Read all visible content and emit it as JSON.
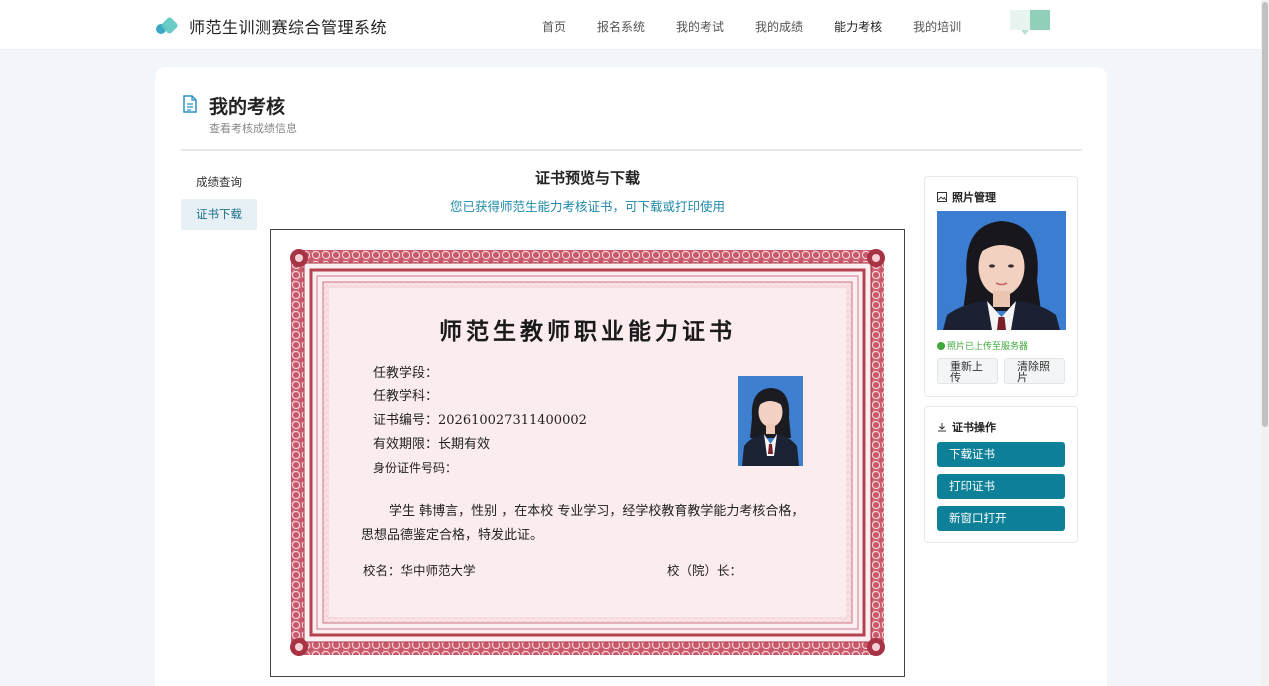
{
  "header": {
    "app_title": "师范生训测赛综合管理系统",
    "nav": [
      {
        "label": "首页"
      },
      {
        "label": "报名系统"
      },
      {
        "label": "我的考试"
      },
      {
        "label": "我的成绩"
      },
      {
        "label": "能力考核"
      },
      {
        "label": "我的培训"
      }
    ],
    "active_nav": "能力考核"
  },
  "page": {
    "title": "我的考核",
    "subtitle": "查看考核成绩信息"
  },
  "side_menu": {
    "items": [
      {
        "label": "成绩查询"
      },
      {
        "label": "证书下载"
      }
    ],
    "active": "证书下载"
  },
  "certificate_section": {
    "title": "证书预览与下载",
    "subtitle": "您已获得师范生能力考核证书，可下载或打印使用"
  },
  "certificate": {
    "title": "师范生教师职业能力证书",
    "field_stage": "任教学段：",
    "field_subject": "任教学科：",
    "field_number": "证书编号：202610027311400002",
    "field_validity": "有效期限：长期有效",
    "field_id": "身份证件号码：",
    "body": "学生 韩博言，性别 ，在本校 专业学习，经学校教育教学能力考核合格，思想品德鉴定合格，特发此证。",
    "school": "校名：华中师范大学",
    "principal": "校（院）长："
  },
  "photo_panel": {
    "title": "照片管理",
    "status": "照片已上传至服务器",
    "reupload_label": "重新上传",
    "clear_label": "清除照片"
  },
  "ops_panel": {
    "title": "证书操作",
    "download_label": "下载证书",
    "print_label": "打印证书",
    "new_window_label": "新窗口打开"
  },
  "colors": {
    "accent": "#0e8097",
    "subtitle": "#1f8aa8",
    "certificate_border": "#b5434f",
    "certificate_fill": "#f9e4e6",
    "success": "#3fa83c"
  }
}
